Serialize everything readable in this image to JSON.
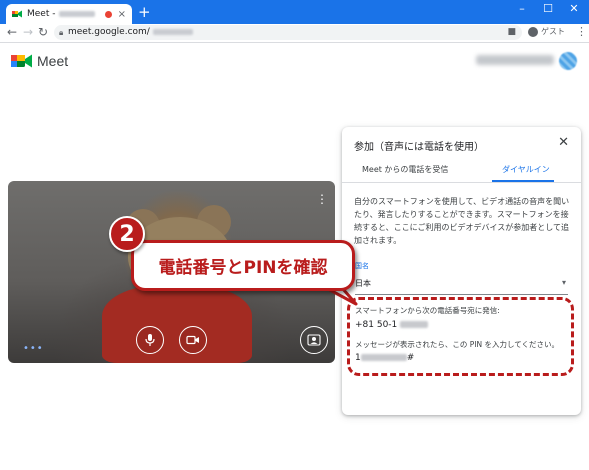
{
  "browser": {
    "tab_title": "Meet -",
    "tab_close": "×",
    "new_tab": "+",
    "url": "meet.google.com/",
    "profile_label": "ゲスト",
    "window_buttons": [
      "–",
      "☐",
      "✕"
    ]
  },
  "meet": {
    "app_name": "Meet"
  },
  "video": {
    "more_label": "⋮",
    "dots_label": "•••"
  },
  "panel": {
    "title": "参加（音声には電話を使用）",
    "close": "✕",
    "tabs": [
      {
        "label": "Meet からの電話を受信"
      },
      {
        "label": "ダイヤルイン"
      }
    ],
    "description": "自分のスマートフォンを使用して、ビデオ通話の音声を聞いたり、発言したりすることができます。スマートフォンを接続すると、ここにご利用のビデオデバイスが参加者として追加されます。",
    "country_label": "国名",
    "country_value": "日本",
    "dial_instructions": "スマートフォンから次の電話番号宛に発信:",
    "phone_prefix": "+81 50-1",
    "pin_instructions": "メッセージが表示されたら、この PIN を入力してください。",
    "pin_prefix": "1",
    "pin_suffix": "#"
  },
  "annotation": {
    "step_number": "2",
    "callout_text": "電話番号とPINを確認",
    "color": "#b91c1c"
  },
  "colors": {
    "chrome_blue": "#1a73e8",
    "meet_blue": "#1a73e8"
  }
}
